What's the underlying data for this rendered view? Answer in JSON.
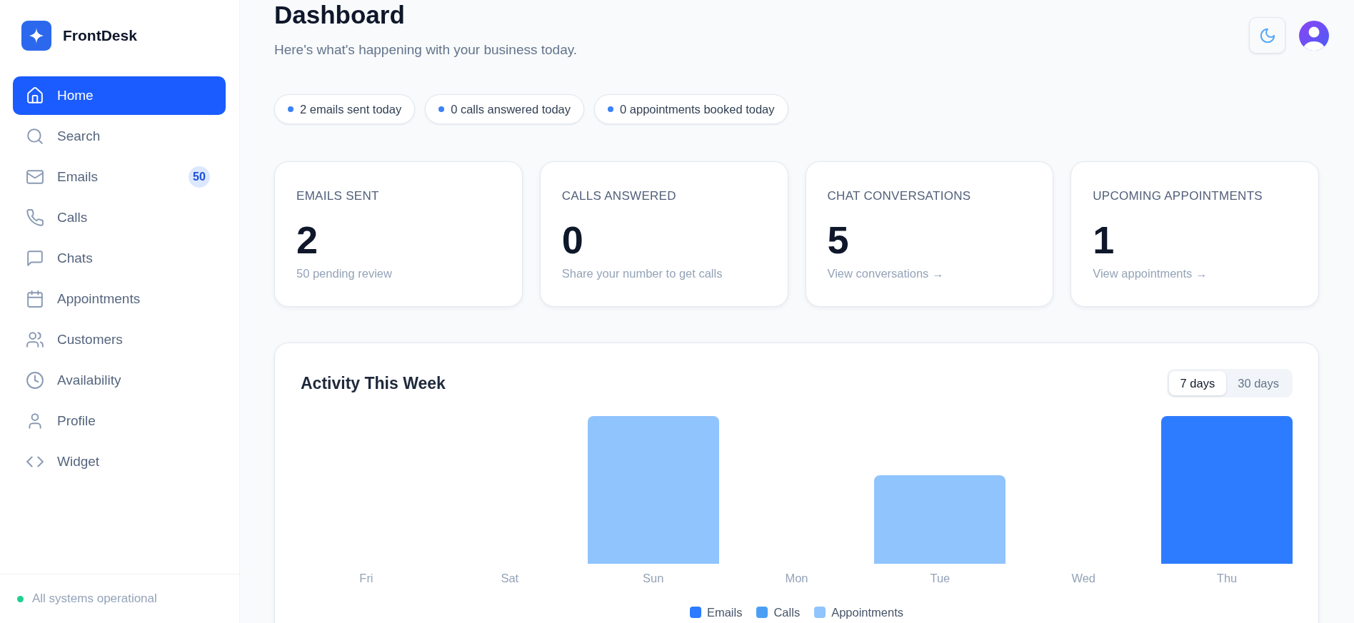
{
  "sidebar": {
    "brand": "FrontDesk",
    "items": [
      {
        "label": "Home",
        "selected": true
      },
      {
        "label": "Search",
        "selected": false
      },
      {
        "label": "Emails",
        "selected": false,
        "badge": "50"
      },
      {
        "label": "Calls",
        "selected": false
      },
      {
        "label": "Chats",
        "selected": false
      },
      {
        "label": "Appointments",
        "selected": false
      },
      {
        "label": "Customers",
        "selected": false
      },
      {
        "label": "Availability",
        "selected": false
      },
      {
        "label": "Profile",
        "selected": false
      },
      {
        "label": "Widget",
        "selected": false
      }
    ],
    "status": {
      "text": "All systems operational",
      "operational": true
    }
  },
  "header": {
    "title": "Dashboard",
    "subtitle": "Here's what's happening with your business today."
  },
  "summary_pills": [
    "2 emails sent today",
    "0 calls answered today",
    "0 appointments booked today"
  ],
  "stat_cards": [
    {
      "label": "EMAILS SENT",
      "value": "2",
      "note": "50 pending review"
    },
    {
      "label": "CALLS ANSWERED",
      "value": "0",
      "note": "Share your number to get calls"
    },
    {
      "label": "CHAT CONVERSATIONS",
      "value": "5",
      "note": "View conversations →"
    },
    {
      "label": "UPCOMING APPOINTMENTS",
      "value": "1",
      "note": "View appointments →"
    }
  ],
  "activity": {
    "title": "Activity This Week",
    "ranges": [
      {
        "label": "7 days",
        "selected": true
      },
      {
        "label": "30 days",
        "selected": false
      }
    ],
    "days": [
      "Fri",
      "Sat",
      "Sun",
      "Mon",
      "Tue",
      "Wed",
      "Thu"
    ],
    "legend": [
      {
        "name": "Emails",
        "color": "#2d7cff"
      },
      {
        "name": "Calls",
        "color": "#4a9ff5"
      },
      {
        "name": "Appointments",
        "color": "#90c4fd"
      }
    ]
  }
}
